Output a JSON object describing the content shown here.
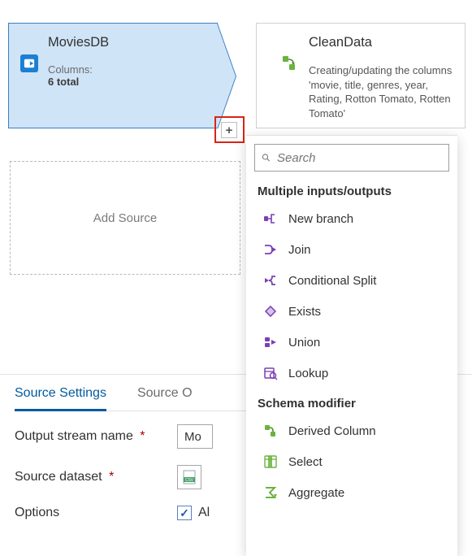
{
  "nodes": {
    "movies": {
      "title": "MoviesDB",
      "columns_label": "Columns:",
      "columns_value": "6 total"
    },
    "clean": {
      "title": "CleanData",
      "description": "Creating/updating the columns 'movie, title, genres, year, Rating, Rotton Tomato, Rotten Tomato'"
    }
  },
  "add_source_label": "Add Source",
  "plus_glyph": "+",
  "dropdown": {
    "search_placeholder": "Search",
    "sections": {
      "multi_header": "Multiple inputs/outputs",
      "schema_header": "Schema modifier"
    },
    "items": {
      "new_branch": "New branch",
      "join": "Join",
      "conditional_split": "Conditional Split",
      "exists": "Exists",
      "union": "Union",
      "lookup": "Lookup",
      "derived_column": "Derived Column",
      "select": "Select",
      "aggregate": "Aggregate"
    }
  },
  "settings": {
    "tabs": {
      "source_settings": "Source Settings",
      "source_other": "Source O",
      "right_tab": "O"
    },
    "output_stream_label": "Output stream name",
    "output_stream_value": "Mo",
    "source_dataset_label": "Source dataset",
    "options_label": "Options",
    "options_checkbox_label": "Al",
    "required_mark": "*",
    "check_glyph": "✓"
  },
  "icons": {
    "source": "database-source",
    "derived": "derived-column",
    "search": "search"
  }
}
